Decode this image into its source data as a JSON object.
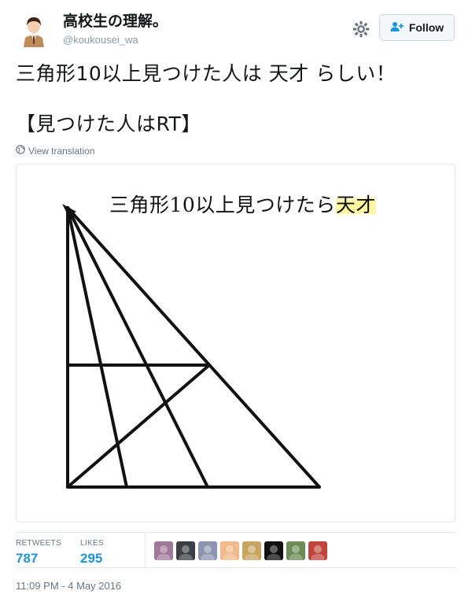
{
  "user": {
    "display_name": "高校生の理解。",
    "screen_name": "@koukousei_wa"
  },
  "actions": {
    "follow_label": "Follow",
    "settings_icon": "gear-icon"
  },
  "tweet": {
    "text_line1": "三角形10以上見つけた人は 天才 らしい！",
    "text_line2": "【見つけた人はRT】",
    "translate_label": "View translation"
  },
  "media": {
    "caption_main": "三角形10以上見つけたら",
    "caption_highlight": "天才"
  },
  "stats": {
    "retweets_label": "RETWEETS",
    "retweets_value": "787",
    "likes_label": "LIKES",
    "likes_value": "295"
  },
  "likers": [
    {
      "name": "liker-avatar-1",
      "color": "#a2789a"
    },
    {
      "name": "liker-avatar-2",
      "color": "#3a3f44"
    },
    {
      "name": "liker-avatar-3",
      "color": "#8c94b0"
    },
    {
      "name": "liker-avatar-4",
      "color": "#f2b98a"
    },
    {
      "name": "liker-avatar-5",
      "color": "#c8a560"
    },
    {
      "name": "liker-avatar-6",
      "color": "#111111"
    },
    {
      "name": "liker-avatar-7",
      "color": "#6d8c54"
    },
    {
      "name": "liker-avatar-8",
      "color": "#c0463c"
    }
  ],
  "timestamp": "11:09 PM - 4 May 2016",
  "colors": {
    "link": "#1b95e0",
    "muted": "#657786",
    "border": "#e1e8ed"
  }
}
